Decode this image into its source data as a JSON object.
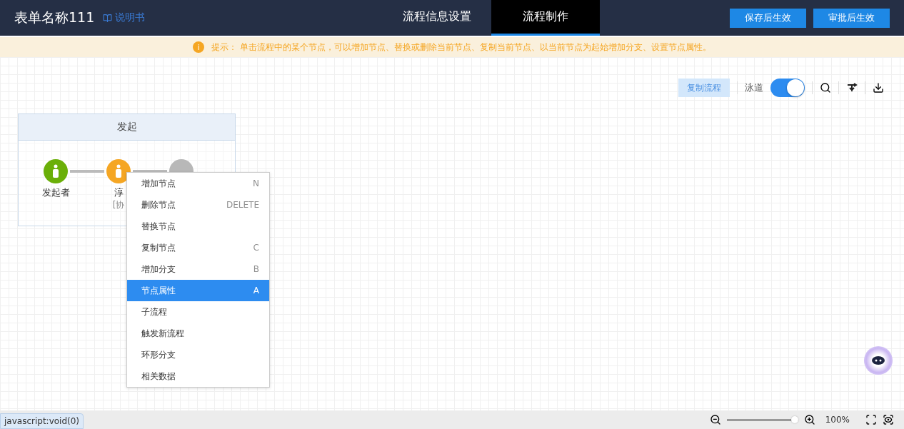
{
  "header": {
    "title": "表单名称111",
    "manual_link": "说明书",
    "tabs": [
      {
        "label": "流程信息设置",
        "selected": false
      },
      {
        "label": "流程制作",
        "selected": true
      }
    ],
    "buttons": [
      "保存后生效",
      "审批后生效"
    ]
  },
  "tip": {
    "icon": "i",
    "text": "提示： 单击流程中的某个节点，可以增加节点、替换或删除当前节点、复制当前节点、以当前节点为起始增加分支、设置节点属性。"
  },
  "toolbar": {
    "copy_button": "复制流程",
    "swimlane": {
      "label": "泳道",
      "on": true
    }
  },
  "lane": {
    "title": "发起",
    "nodes": [
      {
        "kind": "start",
        "label": "发起者",
        "color": "#6aaf08"
      },
      {
        "kind": "person",
        "label": "淳",
        "sublabel": "[协",
        "color": "#f5a623"
      },
      {
        "kind": "end",
        "color": "#b8b8b8"
      }
    ]
  },
  "context_menu": [
    {
      "label": "增加节点",
      "shortcut": "N",
      "selected": false
    },
    {
      "label": "删除节点",
      "shortcut": "DELETE",
      "selected": false
    },
    {
      "label": "替换节点",
      "selected": false
    },
    {
      "label": "复制节点",
      "shortcut": "C",
      "selected": false
    },
    {
      "label": "增加分支",
      "shortcut": "B",
      "selected": false
    },
    {
      "label": "节点属性",
      "shortcut": "A",
      "selected": true
    },
    {
      "label": "子流程",
      "selected": false
    },
    {
      "label": "触发新流程",
      "selected": false
    },
    {
      "label": "环形分支",
      "selected": false
    },
    {
      "label": "相关数据",
      "selected": false
    }
  ],
  "zoom": {
    "level": 1,
    "reading": "100%"
  },
  "status_url": "javascript:void(0)"
}
